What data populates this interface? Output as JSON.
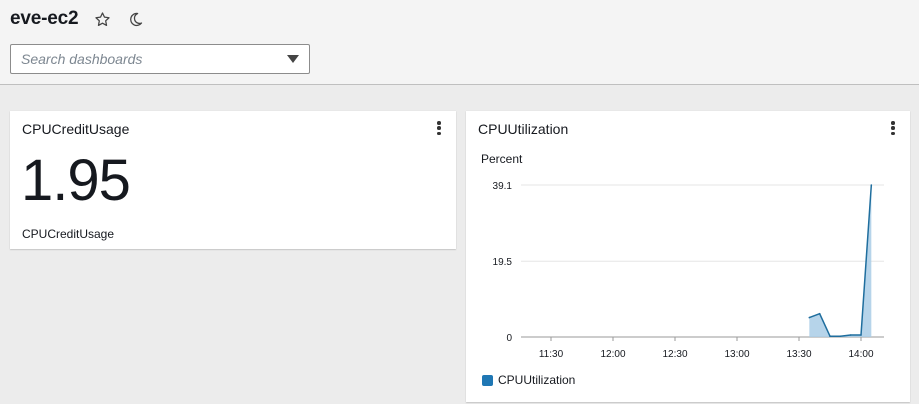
{
  "header": {
    "title": "eve-ec2",
    "favorite_icon": "star-icon",
    "theme_icon": "moon-icon"
  },
  "search": {
    "placeholder": "Search dashboards",
    "value": ""
  },
  "widgets": {
    "credit": {
      "title": "CPUCreditUsage",
      "value": "1.95",
      "metric_label": "CPUCreditUsage"
    },
    "utilization": {
      "title": "CPUUtilization",
      "unit_label": "Percent",
      "legend_label": "CPUUtilization"
    }
  },
  "colors": {
    "series_line": "#1f6e9e",
    "series_fill": "#a9cde6",
    "legend_swatch": "#1f77b4"
  },
  "chart_data": {
    "type": "area",
    "title": "CPUUtilization",
    "ylabel": "Percent",
    "xlabel": "",
    "x_ticks": [
      "11:30",
      "12:00",
      "12:30",
      "13:00",
      "13:30",
      "14:00"
    ],
    "y_ticks": [
      0,
      19.5,
      39.1
    ],
    "ylim": [
      0,
      39.1
    ],
    "grid": true,
    "legend": "bottom-left",
    "series": [
      {
        "name": "CPUUtilization",
        "x": [
          "13:35",
          "13:40",
          "13:45",
          "13:50",
          "13:55",
          "14:00",
          "14:05"
        ],
        "y": [
          5.0,
          6.0,
          0.2,
          0.2,
          0.5,
          0.5,
          39.1
        ]
      }
    ]
  }
}
